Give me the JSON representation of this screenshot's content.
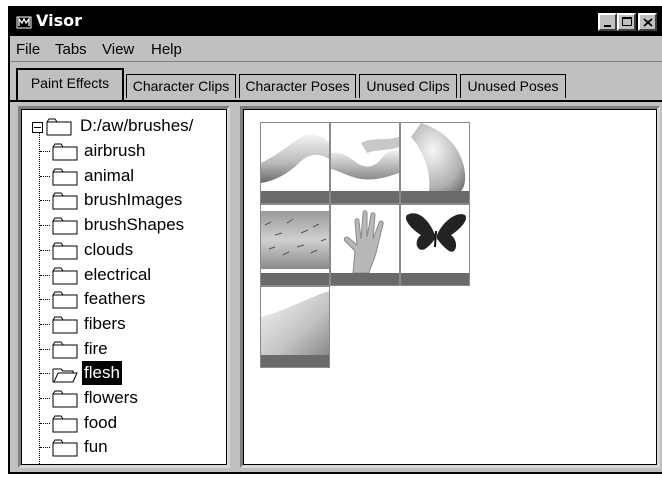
{
  "window": {
    "title": "Visor"
  },
  "menu": [
    "File",
    "Tabs",
    "View",
    "Help"
  ],
  "tabs": [
    {
      "label": "Paint Effects",
      "active": true
    },
    {
      "label": "Character Clips",
      "active": false
    },
    {
      "label": "Character Poses",
      "active": false
    },
    {
      "label": "Unused Clips",
      "active": false
    },
    {
      "label": "Unused Poses",
      "active": false
    }
  ],
  "tree": {
    "root": "D:/aw/brushes/",
    "items": [
      {
        "label": "airbrush"
      },
      {
        "label": "animal"
      },
      {
        "label": "brushImages"
      },
      {
        "label": "brushShapes"
      },
      {
        "label": "clouds"
      },
      {
        "label": "electrical"
      },
      {
        "label": "feathers"
      },
      {
        "label": "fibers"
      },
      {
        "label": "fire"
      },
      {
        "label": "flesh",
        "selected": true
      },
      {
        "label": "flowers"
      },
      {
        "label": "food"
      },
      {
        "label": "fun"
      }
    ]
  },
  "thumbnails": [
    {
      "image": "arm-elbow-flesh"
    },
    {
      "image": "fingers-flesh"
    },
    {
      "image": "smooth-flesh"
    },
    {
      "image": "hairy-arm-flesh"
    },
    {
      "image": "hand-flesh"
    },
    {
      "image": "butterfly-silhouette"
    },
    {
      "image": "smooth-skin-flesh"
    }
  ]
}
